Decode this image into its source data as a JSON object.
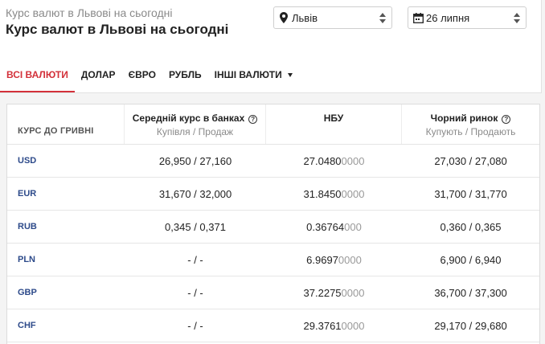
{
  "header": {
    "super_title": "Курс валют в Львові на сьогодні",
    "title": "Курс валют в Львові на сьогодні",
    "city": "Львів",
    "date": "26 липня"
  },
  "tabs": [
    {
      "label": "ВСІ ВАЛЮТИ",
      "active": true
    },
    {
      "label": "ДОЛАР"
    },
    {
      "label": "ЄВРО"
    },
    {
      "label": "РУБЛЬ"
    },
    {
      "label": "ІНШІ ВАЛЮТИ"
    }
  ],
  "table": {
    "col0": "КУРС ДО ГРИВНІ",
    "col1_title": "Середній курс в банках",
    "col1_sub": "Купівля / Продаж",
    "col2_title": "НБУ",
    "col3_title": "Чорний ринок",
    "col3_sub": "Купують / Продають",
    "rows": [
      {
        "code": "USD",
        "banks": "26,950 / 27,160",
        "nbu": "27.0480",
        "nbu_tail": "0000",
        "black": "27,030 / 27,080"
      },
      {
        "code": "EUR",
        "banks": "31,670 / 32,000",
        "nbu": "31.8450",
        "nbu_tail": "0000",
        "black": "31,700 / 31,770"
      },
      {
        "code": "RUB",
        "banks": "0,345 / 0,371",
        "nbu": "0.36764",
        "nbu_tail": "000",
        "black": "0,360 / 0,365"
      },
      {
        "code": "PLN",
        "banks": "- / -",
        "nbu": "6.9697",
        "nbu_tail": "0000",
        "black": "6,900 / 6,940"
      },
      {
        "code": "GBP",
        "banks": "- / -",
        "nbu": "37.2275",
        "nbu_tail": "0000",
        "black": "36,700 / 37,300"
      },
      {
        "code": "CHF",
        "banks": "- / -",
        "nbu": "29.3761",
        "nbu_tail": "0000",
        "black": "29,170 / 29,680"
      }
    ]
  },
  "colors": {
    "accent": "#d3313a",
    "code": "#2d4a8a"
  }
}
